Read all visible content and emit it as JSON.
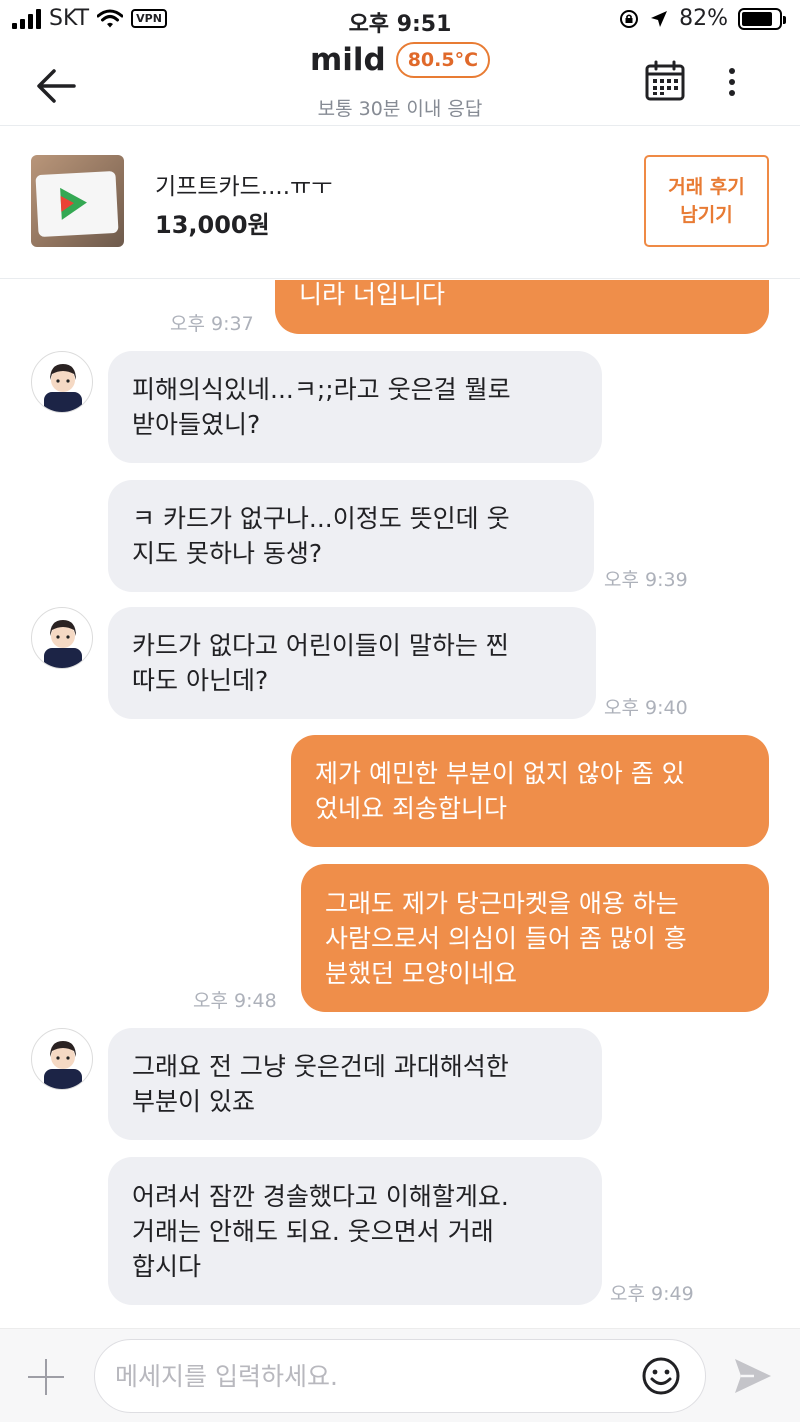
{
  "status_bar": {
    "carrier": "SKT",
    "vpn": "VPN",
    "time": "오후 9:51",
    "battery": "82%",
    "battery_level": 0.82
  },
  "header": {
    "title": "mild",
    "temperature": "80.5°C",
    "subtitle": "보통 30분 이내 응답",
    "accent_color": "#e0692a"
  },
  "product": {
    "name": "기프트카드....ㅠㅜ",
    "price": "13,000원",
    "review_button": "거래 후기\n남기기"
  },
  "messages": [
    {
      "from": "me",
      "text": "니라 너입니다",
      "time": "오후 9:37"
    },
    {
      "from": "them",
      "text": "피해의식있네...ㅋ;;라고 웃은걸 뭘로\n받아들였니?",
      "time": ""
    },
    {
      "from": "them",
      "text": "ㅋ 카드가 없구나...이정도 뜻인데 웃\n지도 못하나 동생?",
      "time": "오후 9:39"
    },
    {
      "from": "them",
      "text": "카드가 없다고 어린이들이 말하는 찐\n따도 아닌데?",
      "time": "오후 9:40"
    },
    {
      "from": "me",
      "text": "제가 예민한 부분이 없지 않아 좀 있\n었네요 죄송합니다",
      "time": ""
    },
    {
      "from": "me",
      "text": "그래도 제가 당근마켓을 애용 하는\n사람으로서 의심이 들어 좀 많이 흥\n분했던 모양이네요",
      "time": "오후 9:48"
    },
    {
      "from": "them",
      "text": "그래요 전 그냥 웃은건데 과대해석한\n부분이 있죠",
      "time": ""
    },
    {
      "from": "them",
      "text": "어려서 잠깐 경솔했다고 이해할게요.\n거래는 안해도 되요. 웃으면서 거래\n합시다",
      "time": "오후 9:49"
    }
  ],
  "input": {
    "placeholder": "메세지를 입력하세요."
  },
  "colors": {
    "my_bubble": "#ef8e4a",
    "their_bubble": "#eeeff3"
  }
}
